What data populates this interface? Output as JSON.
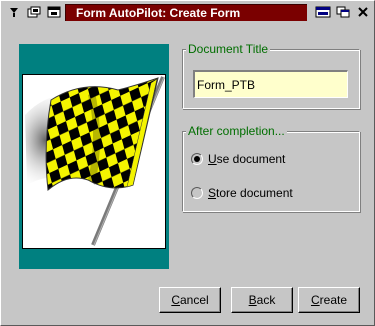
{
  "window": {
    "title": "Form AutoPilot: Create Form",
    "title_icons": [
      "pin-icon",
      "copy-icon",
      "window-icon"
    ],
    "right_icons": [
      "minimize-icon",
      "restore-icon",
      "close-icon"
    ]
  },
  "document_title": {
    "legend": "Document Title",
    "value": "Form_PTB"
  },
  "after_completion": {
    "legend": "After completion...",
    "options": [
      {
        "label_underline": "U",
        "label_rest": "se document",
        "checked": true
      },
      {
        "label_underline": "S",
        "label_rest": "tore document",
        "checked": false
      }
    ]
  },
  "buttons": {
    "cancel": {
      "underline": "C",
      "rest": "ancel"
    },
    "back": {
      "underline": "B",
      "rest": "ack"
    },
    "create": {
      "underline": "C",
      "rest": "reate"
    }
  },
  "colors": {
    "titlebar_bg": "#7a0000",
    "legend_text": "#006e00",
    "image_panel_bg": "#008080",
    "field_bg": "#ffffcc"
  }
}
